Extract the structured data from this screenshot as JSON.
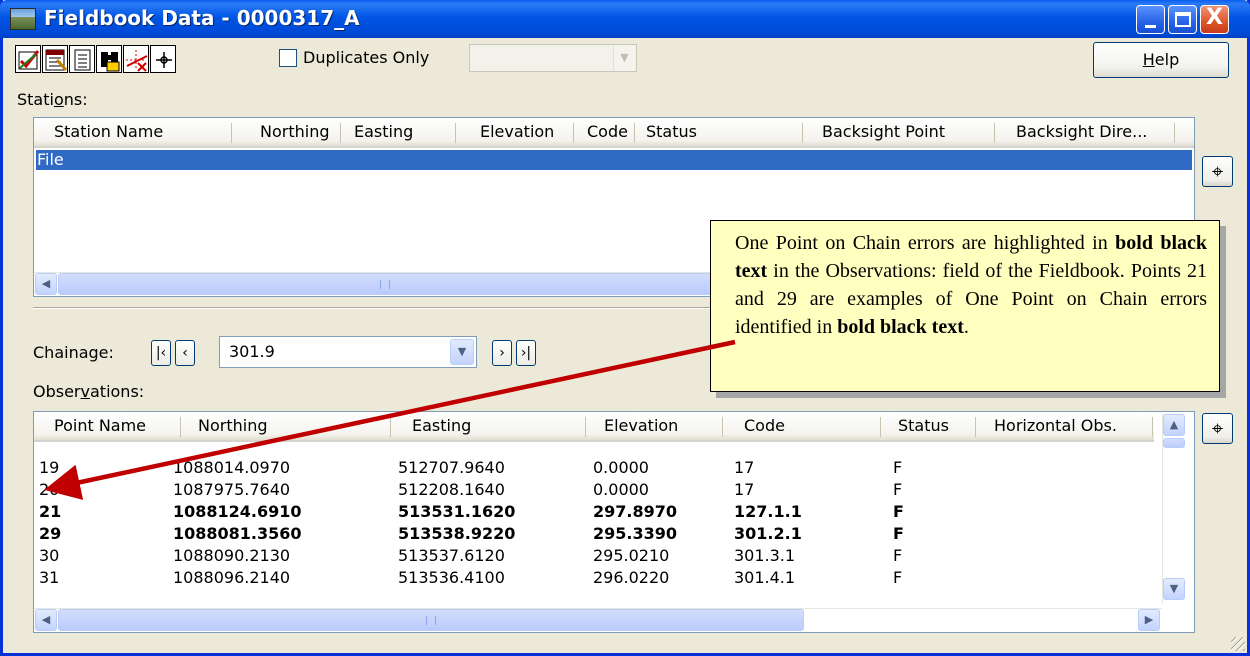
{
  "window": {
    "title": "Fieldbook Data - 0000317_A",
    "controls": {
      "minimize": "_",
      "maximize": "□",
      "close": "X"
    }
  },
  "toolbar": {
    "icons": [
      "check-edit-icon",
      "table-edit-icon",
      "list-icon",
      "binoculars-icon",
      "point-edit-icon",
      "crosshair-icon"
    ],
    "duplicates_only": {
      "label": "Duplicates Only",
      "checked": false
    },
    "filter_combo": {
      "value": "",
      "enabled": false
    },
    "help_label": "Help",
    "help_mnemonic": "H",
    "help_rest": "elp"
  },
  "stations": {
    "label_pre": "Stati",
    "label_mnemonic": "o",
    "label_post": "ns:",
    "columns": [
      "Station Name",
      "Northing",
      "Easting",
      "Elevation",
      "Code",
      "Status",
      "Backsight Point",
      "Backsight Dire..."
    ],
    "rows": [
      {
        "name": "File",
        "selected": true
      }
    ]
  },
  "chainage": {
    "label": "Chainage:",
    "value": "301.9",
    "nav": {
      "first": "|<",
      "prev": "<",
      "next": ">",
      "last": ">|"
    }
  },
  "observations": {
    "label_pre": "Obser",
    "label_mnemonic": "v",
    "label_post": "ations:",
    "columns": [
      "Point Name",
      "Northing",
      "Easting",
      "Elevation",
      "Code",
      "Status",
      "Horizontal Obs."
    ],
    "rows": [
      {
        "point": "19",
        "northing": "1088014.0970",
        "easting": "512707.9640",
        "elevation": "0.0000",
        "code": "17",
        "status": "F",
        "bold": false
      },
      {
        "point": "20",
        "northing": "1087975.7640",
        "easting": "512208.1640",
        "elevation": "0.0000",
        "code": "17",
        "status": "F",
        "bold": false
      },
      {
        "point": "21",
        "northing": "1088124.6910",
        "easting": "513531.1620",
        "elevation": "297.8970",
        "code": "127.1.1",
        "status": "F",
        "bold": true
      },
      {
        "point": "29",
        "northing": "1088081.3560",
        "easting": "513538.9220",
        "elevation": "295.3390",
        "code": "301.2.1",
        "status": "F",
        "bold": true
      },
      {
        "point": "30",
        "northing": "1088090.2130",
        "easting": "513537.6120",
        "elevation": "295.0210",
        "code": "301.3.1",
        "status": "F",
        "bold": false
      },
      {
        "point": "31",
        "northing": "1088096.2140",
        "easting": "513536.4100",
        "elevation": "296.0220",
        "code": "301.4.1",
        "status": "F",
        "bold": false
      }
    ]
  },
  "callout": {
    "segments": [
      {
        "text": "One Point on Chain errors are highlighted in ",
        "bold": false
      },
      {
        "text": "bold black text",
        "bold": true
      },
      {
        "text": " in the Observations:  field of the Fieldbook.  Points 21 and 29 are examples of One Point on Chain errors identified in ",
        "bold": false
      },
      {
        "text": "bold black text",
        "bold": true
      },
      {
        "text": ".",
        "bold": false
      }
    ]
  },
  "colors": {
    "titlebar": "#0055e5",
    "selection": "#316ac5",
    "callout_bg": "#ffffc0",
    "arrow": "#c00000",
    "dialog_bg": "#ece9d8"
  }
}
